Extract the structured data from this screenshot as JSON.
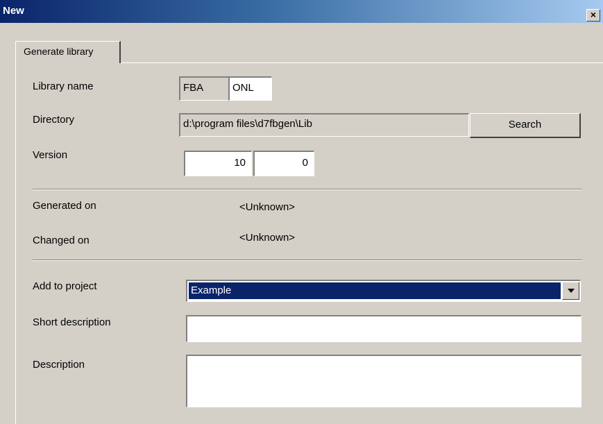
{
  "window": {
    "title": "New",
    "close_glyph": "×"
  },
  "tabs": [
    {
      "label": "Generate library",
      "active": true
    }
  ],
  "library_name": {
    "label": "Library name",
    "prefix": "FBA",
    "value": "ONL"
  },
  "directory": {
    "label": "Directory",
    "value": "d:\\program files\\d7fbgen\\Lib",
    "search_label": "Search"
  },
  "version": {
    "label": "Version",
    "major": "10",
    "minor": "0"
  },
  "generated_on": {
    "label": "Generated on",
    "value": "<Unknown>"
  },
  "changed_on": {
    "label": "Changed on",
    "value": "<Unknown>"
  },
  "add_to_project": {
    "label": "Add to project",
    "selected": "Example"
  },
  "short_description": {
    "label": "Short description",
    "value": ""
  },
  "description": {
    "label": "Description",
    "value": ""
  },
  "colors": {
    "title_start": "#0a246a",
    "title_end": "#a6caf0",
    "dialog_bg": "#d4d0c8",
    "selection": "#0a246a"
  },
  "icons": {
    "close": "close-icon",
    "dropdown": "chevron-down-icon"
  }
}
